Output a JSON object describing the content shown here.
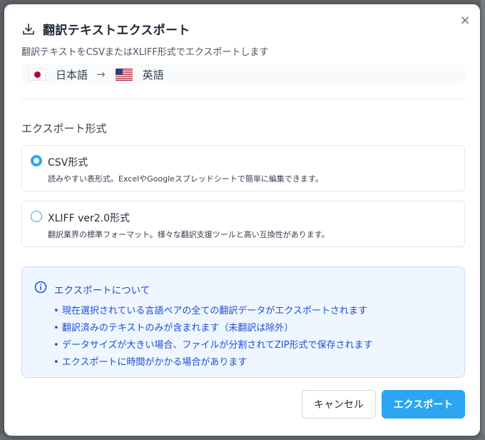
{
  "dialog": {
    "title": "翻訳テキストエクスポート",
    "subtitle": "翻訳テキストをCSVまたはXLIFF形式でエクスポートします",
    "close_symbol": "×"
  },
  "languages": {
    "source": "日本語",
    "target": "英語",
    "arrow": "→"
  },
  "format_section": {
    "label": "エクスポート形式",
    "selected": "csv",
    "options": [
      {
        "id": "csv",
        "title": "CSV形式",
        "description": "読みやすい表形式。ExcelやGoogleスプレッドシートで簡単に編集できます。"
      },
      {
        "id": "xliff",
        "title": "XLIFF ver2.0形式",
        "description": "翻訳業界の標準フォーマット。様々な翻訳支援ツールと高い互換性があります。"
      }
    ]
  },
  "info": {
    "title": "エクスポートについて",
    "items": [
      "現在選択されている言語ペアの全ての翻訳データがエクスポートされます",
      "翻訳済みのテキストのみが含まれます（未翻訳は除外）",
      "データサイズが大きい場合、ファイルが分割されてZIP形式で保存されます",
      "エクスポートに時間がかかる場合があります"
    ]
  },
  "buttons": {
    "cancel": "キャンセル",
    "export": "エクスポート"
  },
  "colors": {
    "accent": "#2aa7f0",
    "info_text": "#1d4ed8",
    "info_bg": "#eff6ff"
  },
  "icons": {
    "title": "download-icon",
    "info": "info-circle-icon",
    "close": "close-icon"
  }
}
